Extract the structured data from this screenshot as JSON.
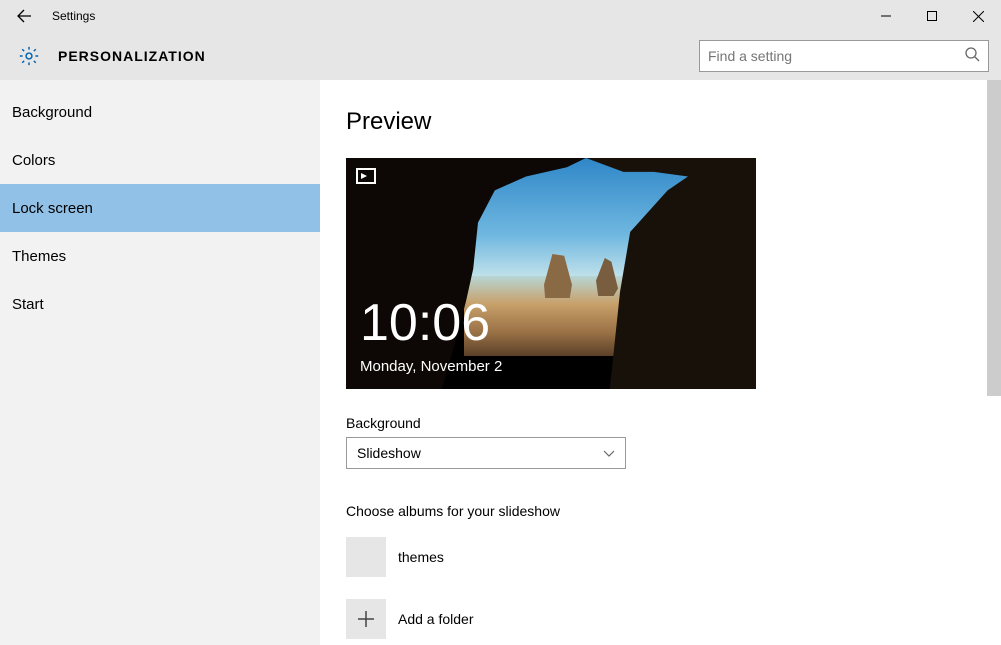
{
  "window": {
    "title": "Settings"
  },
  "header": {
    "title": "PERSONALIZATION",
    "search_placeholder": "Find a setting"
  },
  "sidebar": {
    "items": [
      {
        "label": "Background",
        "selected": false
      },
      {
        "label": "Colors",
        "selected": false
      },
      {
        "label": "Lock screen",
        "selected": true
      },
      {
        "label": "Themes",
        "selected": false
      },
      {
        "label": "Start",
        "selected": false
      }
    ]
  },
  "content": {
    "preview_heading": "Preview",
    "clock_time": "10:06",
    "clock_date": "Monday, November 2",
    "background_label": "Background",
    "background_value": "Slideshow",
    "albums_label": "Choose albums for your slideshow",
    "albums": [
      {
        "name": "themes"
      }
    ],
    "add_folder_label": "Add a folder"
  }
}
